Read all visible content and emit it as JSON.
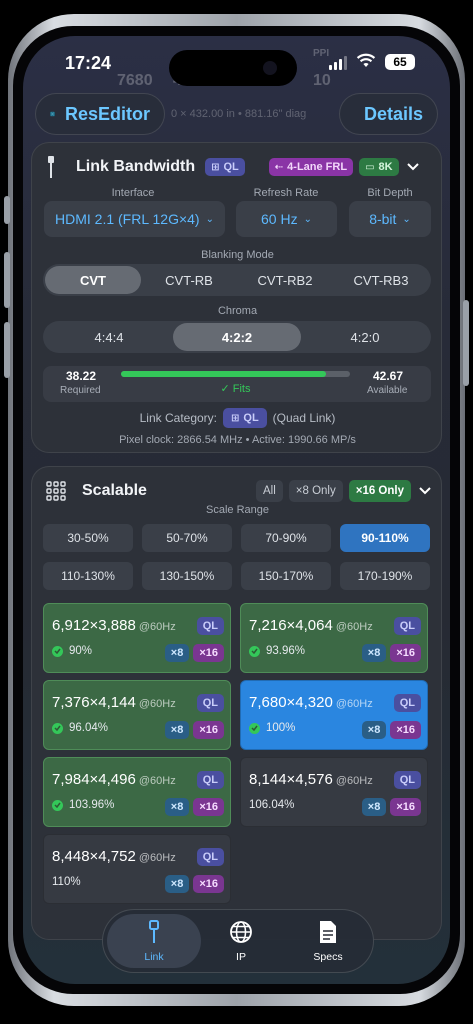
{
  "status": {
    "time": "17:24",
    "battery": "65",
    "ghost_ppi": "PPI",
    "ghost_width": "7680",
    "ghost_height_prefix": "4",
    "ghost_ppi_value": "10"
  },
  "nav": {
    "app_title": "ResEditor",
    "details_label": "Details",
    "behind_text": "0 × 432.00 in  •  881.16\" diag"
  },
  "link": {
    "title": "Link Bandwidth",
    "badge_ql": "QL",
    "badge_frl": "4-Lane FRL",
    "badge_8k": "8K",
    "interface_label": "Interface",
    "interface_value": "HDMI 2.1 (FRL 12G×4)",
    "refresh_label": "Refresh Rate",
    "refresh_value": "60 Hz",
    "depth_label": "Bit Depth",
    "depth_value": "8-bit",
    "blanking_label": "Blanking Mode",
    "blanking_options": [
      "CVT",
      "CVT-RB",
      "CVT-RB2",
      "CVT-RB3"
    ],
    "blanking_selected": "CVT",
    "chroma_label": "Chroma",
    "chroma_options": [
      "4:4:4",
      "4:2:2",
      "4:2:0"
    ],
    "chroma_selected": "4:2:2",
    "required_value": "38.22",
    "required_label": "Required",
    "available_value": "42.67",
    "available_label": "Available",
    "usage_fraction": 0.896,
    "fits_label": "✓ Fits",
    "category_label": "Link Category:",
    "category_badge": "QL",
    "category_desc": "(Quad Link)",
    "pixel_clock": "Pixel clock: 2866.54 MHz • Active: 1990.66 MP/s"
  },
  "scalable": {
    "title": "Scalable",
    "filters": [
      "All",
      "×8 Only",
      "×16 Only"
    ],
    "filter_selected": "×16 Only",
    "range_label": "Scale Range",
    "ranges": [
      "30-50%",
      "50-70%",
      "70-90%",
      "90-110%",
      "110-130%",
      "130-150%",
      "150-170%",
      "170-190%"
    ],
    "range_selected": "90-110%",
    "results": [
      {
        "res": "6,912×3,888",
        "hz": "@60Hz",
        "ql": "QL",
        "pct": "90%",
        "ok": true,
        "style": "green",
        "x8": "×8",
        "x16": "×16"
      },
      {
        "res": "7,216×4,064",
        "hz": "@60Hz",
        "ql": "QL",
        "pct": "93.96%",
        "ok": true,
        "style": "green",
        "x8": "×8",
        "x16": "×16"
      },
      {
        "res": "7,376×4,144",
        "hz": "@60Hz",
        "ql": "QL",
        "pct": "96.04%",
        "ok": true,
        "style": "green",
        "x8": "×8",
        "x16": "×16"
      },
      {
        "res": "7,680×4,320",
        "hz": "@60Hz",
        "ql": "QL",
        "pct": "100%",
        "ok": true,
        "style": "blue",
        "x8": "×8",
        "x16": "×16"
      },
      {
        "res": "7,984×4,496",
        "hz": "@60Hz",
        "ql": "QL",
        "pct": "103.96%",
        "ok": true,
        "style": "green",
        "x8": "×8",
        "x16": "×16"
      },
      {
        "res": "8,144×4,576",
        "hz": "@60Hz",
        "ql": "QL",
        "pct": "106.04%",
        "ok": false,
        "style": "gray",
        "x8": "×8",
        "x16": "×16"
      },
      {
        "res": "8,448×4,752",
        "hz": "@60Hz",
        "ql": "QL",
        "pct": "110%",
        "ok": false,
        "style": "gray",
        "x8": "×8",
        "x16": "×16"
      }
    ]
  },
  "tabs": [
    {
      "label": "Link",
      "icon": "link-cable-icon",
      "active": true
    },
    {
      "label": "IP",
      "icon": "globe-icon",
      "active": false
    },
    {
      "label": "Specs",
      "icon": "document-icon",
      "active": false
    }
  ],
  "colors": {
    "accent": "#5db9ff",
    "fits_green": "#34c759",
    "selected_blue": "#2a86e0",
    "ql_purple": "#4a4fa0",
    "frl_purple": "#8a34a6"
  }
}
